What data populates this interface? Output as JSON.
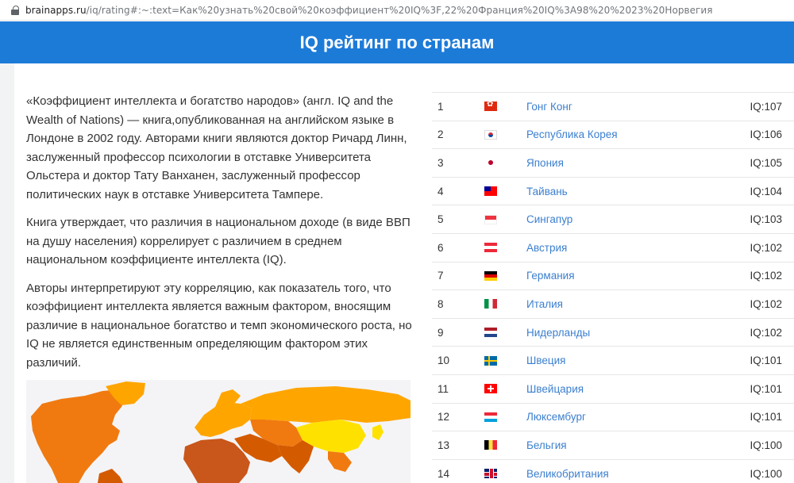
{
  "browser": {
    "url_host": "brainapps.ru",
    "url_rest": "/iq/rating#:~:text=Как%20узнать%20свой%20коэффициент%20IQ%3F,22%20Франция%20IQ%3A98%20%2023%20Норвегия"
  },
  "header": {
    "title": "IQ рейтинг по странам"
  },
  "article": {
    "paragraphs": [
      "«Коэффициент интеллекта и богатство народов» (англ. IQ and the Wealth of Nations) — книга,опубликованная на английском языке в Лондоне в 2002 году. Авторами книги являются доктор Ричард Линн, заслуженный профессор психологии в отставке Университета Ольстера и доктор Тату Ванханен, заслуженный профессор политических наук в отставке Университета Тампере.",
      "Книга утверждает, что различия в национальном доходе (в виде ВВП на душу населения) коррелирует с различием в среднем национальном коэффициенте интеллекта (IQ).",
      "Авторы интерпретируют эту корреляцию, как показатель того, что коэффициент интеллекта является важным фактором, вносящим различие в национальное богатство и темп экономического роста, но IQ не является единственным определяющим фактором этих различий."
    ]
  },
  "map": {
    "colors": {
      "high": "#ffe100",
      "mid": "#ffa500",
      "low": "#f07a10",
      "lower": "#d45a00",
      "ocean": "#f4f4f6"
    }
  },
  "rating": [
    {
      "rank": "1",
      "flag": "hk",
      "country": "Гонг Конг",
      "iq": "IQ:107"
    },
    {
      "rank": "2",
      "flag": "kr",
      "country": "Республика Корея",
      "iq": "IQ:106"
    },
    {
      "rank": "3",
      "flag": "jp",
      "country": "Япония",
      "iq": "IQ:105"
    },
    {
      "rank": "4",
      "flag": "tw",
      "country": "Тайвань",
      "iq": "IQ:104"
    },
    {
      "rank": "5",
      "flag": "sg",
      "country": "Сингапур",
      "iq": "IQ:103"
    },
    {
      "rank": "6",
      "flag": "at",
      "country": "Австрия",
      "iq": "IQ:102"
    },
    {
      "rank": "7",
      "flag": "de",
      "country": "Германия",
      "iq": "IQ:102"
    },
    {
      "rank": "8",
      "flag": "it",
      "country": "Италия",
      "iq": "IQ:102"
    },
    {
      "rank": "9",
      "flag": "nl",
      "country": "Нидерланды",
      "iq": "IQ:102"
    },
    {
      "rank": "10",
      "flag": "se",
      "country": "Швеция",
      "iq": "IQ:101"
    },
    {
      "rank": "11",
      "flag": "ch",
      "country": "Швейцария",
      "iq": "IQ:101"
    },
    {
      "rank": "12",
      "flag": "lu",
      "country": "Люксембург",
      "iq": "IQ:101"
    },
    {
      "rank": "13",
      "flag": "be",
      "country": "Бельгия",
      "iq": "IQ:100"
    },
    {
      "rank": "14",
      "flag": "gb",
      "country": "Великобритания",
      "iq": "IQ:100"
    }
  ]
}
